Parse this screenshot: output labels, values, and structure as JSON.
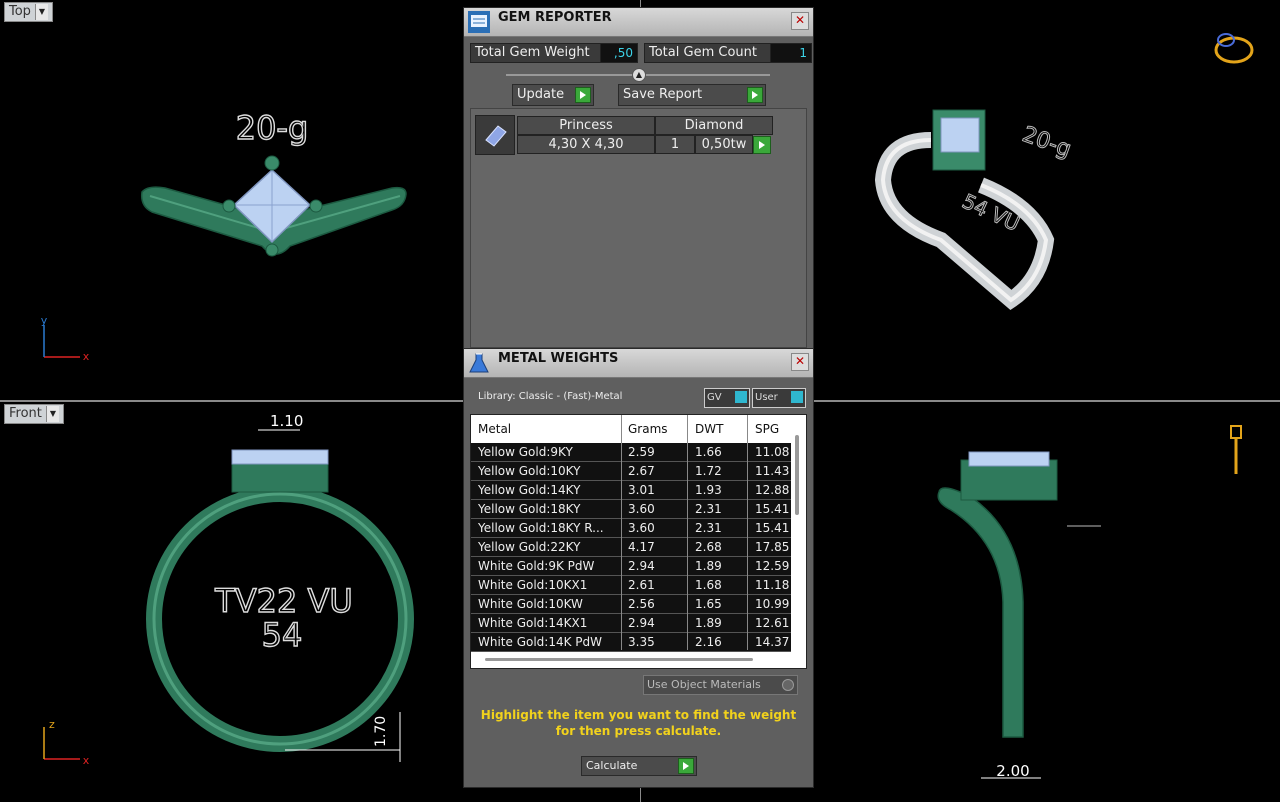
{
  "viewports": {
    "top": {
      "label": "Top",
      "text": "20-g",
      "axis_y": "y",
      "axis_x": "x"
    },
    "persp": {
      "text1": "20-g",
      "text2": "54 VU"
    },
    "front": {
      "label": "Front",
      "dim_top": "1.10",
      "text1": "TV22 VU",
      "text2": "54",
      "dim_side": "1.70",
      "axis_y": "z",
      "axis_x": "x"
    },
    "right": {
      "dim_bottom": "2.00"
    }
  },
  "gem_reporter": {
    "title": "GEM REPORTER",
    "total_weight_label": "Total Gem Weight",
    "total_weight_value": ",50",
    "total_count_label": "Total Gem Count",
    "total_count_value": "1",
    "update_label": "Update",
    "save_label": "Save Report",
    "gem": {
      "shape": "Princess",
      "type": "Diamond",
      "size": "4,30 X 4,30",
      "count": "1",
      "weight": "0,50tw"
    }
  },
  "metal_weights": {
    "title": "METAL WEIGHTS",
    "library": "Library: Classic - (Fast)-Metal",
    "toggle_gv": "GV",
    "toggle_user": "User",
    "columns": [
      "Metal",
      "Grams",
      "DWT",
      "SPG"
    ],
    "rows": [
      [
        "Yellow Gold:9KY",
        "2.59",
        "1.66",
        "11.08"
      ],
      [
        "Yellow Gold:10KY",
        "2.67",
        "1.72",
        "11.43"
      ],
      [
        "Yellow Gold:14KY",
        "3.01",
        "1.93",
        "12.88"
      ],
      [
        "Yellow Gold:18KY",
        "3.60",
        "2.31",
        "15.41"
      ],
      [
        "Yellow Gold:18KY R...",
        "3.60",
        "2.31",
        "15.41"
      ],
      [
        "Yellow Gold:22KY",
        "4.17",
        "2.68",
        "17.85"
      ],
      [
        "White Gold:9K PdW",
        "2.94",
        "1.89",
        "12.59"
      ],
      [
        "White Gold:10KX1",
        "2.61",
        "1.68",
        "11.18"
      ],
      [
        "White Gold:10KW",
        "2.56",
        "1.65",
        "10.99"
      ],
      [
        "White Gold:14KX1",
        "2.94",
        "1.89",
        "12.61"
      ],
      [
        "White Gold:14K PdW",
        "3.35",
        "2.16",
        "14.37"
      ]
    ],
    "use_object_materials": "Use Object Materials",
    "instruction_line1": "Highlight the item you want to find the weight",
    "instruction_line2": "for then press calculate.",
    "calculate_label": "Calculate"
  },
  "colors": {
    "ring_green": "#2f7a5c",
    "instruction_yellow": "#f2d21c",
    "value_cyan": "#3cd3e8"
  }
}
